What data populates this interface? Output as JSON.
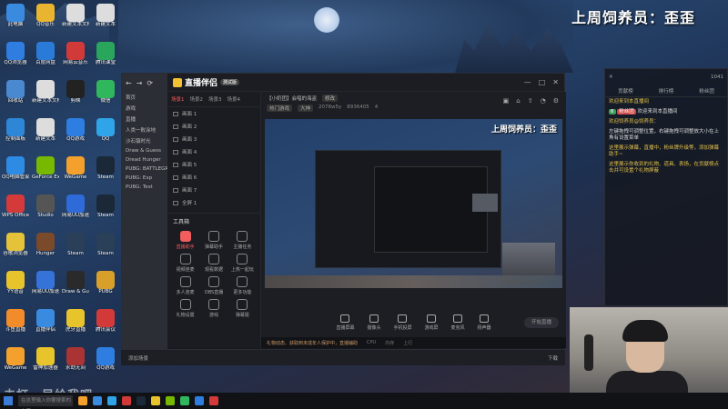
{
  "stream_title": "上周饲养员：歪歪",
  "desktop_icons": [
    {
      "label": "此电脑",
      "color": "#3a8be0"
    },
    {
      "label": "QQ音乐",
      "color": "#e9b430"
    },
    {
      "label": "新建文本文档",
      "color": "#ddd"
    },
    {
      "label": "新建文本",
      "color": "#ddd"
    },
    {
      "label": "QQ浏览器",
      "color": "#2f7de0"
    },
    {
      "label": "百度网盘",
      "color": "#2a7bd8"
    },
    {
      "label": "网易云音乐",
      "color": "#d23a3a"
    },
    {
      "label": "腾讯课堂",
      "color": "#29a55c"
    },
    {
      "label": "回收站",
      "color": "#4a88d0"
    },
    {
      "label": "新建文本文档",
      "color": "#ddd"
    },
    {
      "label": "剪映",
      "color": "#222"
    },
    {
      "label": "微信",
      "color": "#30b65c"
    },
    {
      "label": "控制面板",
      "color": "#2e86d6"
    },
    {
      "label": "新建文本",
      "color": "#ddd"
    },
    {
      "label": "QQ游戏",
      "color": "#2d7ee0"
    },
    {
      "label": "QQ",
      "color": "#2fa4e8"
    },
    {
      "label": "QQ电脑管家",
      "color": "#2e8be4"
    },
    {
      "label": "GeForce Experience",
      "color": "#76b900"
    },
    {
      "label": "WeGame",
      "color": "#f3a02c"
    },
    {
      "label": "Steam",
      "color": "#1b2838"
    },
    {
      "label": "WPS Office",
      "color": "#d43a3a"
    },
    {
      "label": "Studio",
      "color": "#555"
    },
    {
      "label": "网易UU加速器",
      "color": "#2e6bd9"
    },
    {
      "label": "Steam",
      "color": "#1b2838"
    },
    {
      "label": "谷歌浏览器",
      "color": "#e4c33a"
    },
    {
      "label": "Hunger",
      "color": "#7a4a2a"
    },
    {
      "label": "Steam",
      "color": "#2a4058"
    },
    {
      "label": "Steam",
      "color": "#2a4058"
    },
    {
      "label": "YY语音",
      "color": "#e7c32c"
    },
    {
      "label": "网易UU加速",
      "color": "#3573d8"
    },
    {
      "label": "Draw & Guess",
      "color": "#2a2a2a"
    },
    {
      "label": "PUBG",
      "color": "#d8a02a"
    },
    {
      "label": "斗鱼直播",
      "color": "#f28c2b"
    },
    {
      "label": "直播伴侣",
      "color": "#3a8be0"
    },
    {
      "label": "虎牙直播",
      "color": "#e7c32c"
    },
    {
      "label": "腾讯会议",
      "color": "#d23a3a"
    },
    {
      "label": "WeGame",
      "color": "#f3a02c"
    },
    {
      "label": "雷神加速器",
      "color": "#e7c32c"
    },
    {
      "label": "永劫无间",
      "color": "#a33"
    },
    {
      "label": "QQ游戏",
      "color": "#2d7ee0"
    }
  ],
  "app": {
    "name": "直播伴侣",
    "badge": "测试版",
    "browser_nav": [
      "←",
      "→",
      "⟳"
    ],
    "browser_rows": [
      "首页",
      "游戏",
      "直播",
      "人类一败涂地",
      "沙石镇时光",
      "Draw & Guess",
      "Dread Hunger",
      "PUBG: BATTLEGROUNDS",
      "PUBG: Exp",
      "PUBG: Test"
    ],
    "scene_tabs": [
      "场景1",
      "场景2",
      "场景3",
      "场景4"
    ],
    "scenes": [
      "画面 1",
      "画面 2",
      "画面 3",
      "画面 4",
      "画面 5",
      "画面 6",
      "画面 7",
      "全屏 1"
    ],
    "tools_title": "工具箱",
    "tools": [
      {
        "label": "直播助手",
        "hot": true
      },
      {
        "label": "弹幕助手",
        "hot": false
      },
      {
        "label": "主播任务",
        "hot": false
      },
      {
        "label": "视频连麦",
        "hot": false
      },
      {
        "label": "观看数据",
        "hot": false
      },
      {
        "label": "上热一起玩",
        "hot": false
      },
      {
        "label": "多人连麦",
        "hot": false
      },
      {
        "label": "OBS直播",
        "hot": false
      },
      {
        "label": "更多功能",
        "hot": false
      },
      {
        "label": "礼物设置",
        "hot": false
      },
      {
        "label": "游戏",
        "hot": false
      },
      {
        "label": "弹幕姬",
        "hot": false
      }
    ],
    "room_title": "【小奶团】会唱的海盗",
    "room_tag": "修改",
    "room_meta": [
      "热门游戏",
      "大神",
      "2078w5y",
      "8936405",
      "4"
    ],
    "preview_caption": "上周饲养员：歪歪",
    "controls": [
      "直播屏幕",
      "摄像头",
      "手机投屏",
      "游戏屏",
      "麦克风",
      "扬声器"
    ],
    "start_label": "开始直播",
    "status": [
      "礼物动态、弹幕条幅等在直播中可查看",
      "CPU",
      "内存",
      "上行"
    ],
    "status_warn": "礼物动态、获取到未成年人保护中，直播辅助"
  },
  "chat": {
    "count": "1041",
    "tabs": [
      "贡献榜",
      "排行榜",
      "粉丝团"
    ],
    "messages": [
      {
        "type": "sys",
        "text": "欢迎来到本直播间"
      },
      {
        "type": "user",
        "level": "6",
        "fan": "粉丝团",
        "text": "欢迎来到本直播间"
      },
      {
        "type": "sys",
        "text": "欢迎饲养员@饲养员："
      },
      {
        "type": "plain",
        "text": "左键拖拽可调整位置，右键拖拽可调整放大小在上角有设置菜单"
      },
      {
        "type": "sys",
        "text": "这里展示弹幕，直播中，粉丝牌升级等，添加弹幕助手~"
      },
      {
        "type": "sys",
        "text": "这里展示你收到的礼物、道具、表扬，在贡献榜点击并可设置个礼物屏蔽"
      }
    ]
  },
  "subbar": {
    "left": "添加场景",
    "right": "下载"
  },
  "overlay_text": "去打一局给我吧~",
  "taskbar": {
    "search_placeholder": "在这里输入你要搜索的内容",
    "apps": [
      "#f3a02c",
      "#3a8be0",
      "#2fa4e8",
      "#d23a3a",
      "#1b2838",
      "#e7c32c",
      "#76b900",
      "#30b65c",
      "#2d7ee0",
      "#d43a3a"
    ]
  }
}
